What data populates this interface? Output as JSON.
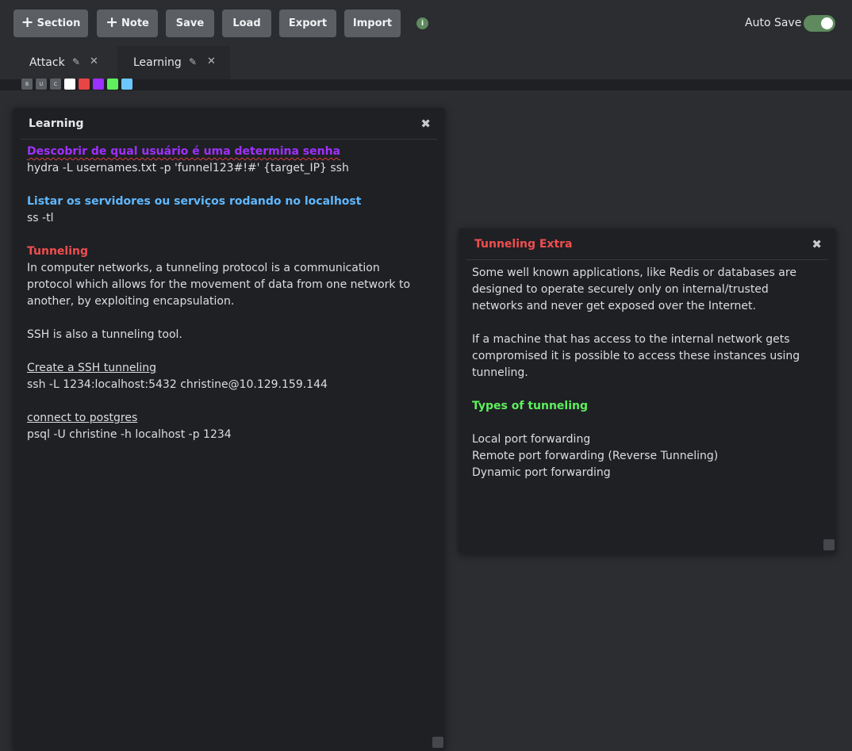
{
  "toolbar": {
    "add_section_label": "Section",
    "add_note_label": "Note",
    "save_label": "Save",
    "load_label": "Load",
    "export_label": "Export",
    "import_label": "Import",
    "info_glyph": "i",
    "autosave_label": "Auto Save",
    "autosave_on": true
  },
  "tabs": [
    {
      "label": "Attack",
      "active": false
    },
    {
      "label": "Learning",
      "active": true
    }
  ],
  "tab_glyphs": {
    "edit": "✎",
    "close": "✕"
  },
  "format_bar": {
    "buttons": [
      "B",
      "U",
      "C"
    ],
    "colors": [
      "#ffffff",
      "#e84545",
      "#9b30ff",
      "#5ef05e",
      "#6ec6ff"
    ]
  },
  "notes": {
    "learning": {
      "title": "Learning",
      "title_color": "#e6e7e9",
      "close_glyph": "✖",
      "lines": {
        "l1": "Descobrir de qual usuário é uma determina senha",
        "l2": "hydra -L usernames.txt -p 'funnel123#!#' {target_IP} ssh",
        "l3": "Listar os servidores ou serviços rodando no localhost",
        "l4": "ss -tl",
        "l5": "Tunneling",
        "l6": "In computer networks, a tunneling protocol is a communication protocol which allows for the movement of data from one network to another, by exploiting encapsulation.",
        "l7": "SSH is also a tunneling tool.",
        "l8": "Create a SSH tunneling",
        "l9": "ssh -L 1234:localhost:5432 christine@10.129.159.144",
        "l10": "connect to postgres",
        "l11": "psql -U christine -h localhost -p 1234"
      }
    },
    "tunneling_extra": {
      "title": "Tunneling Extra",
      "title_color": "#f04e4e",
      "close_glyph": "✖",
      "lines": {
        "p1": "Some well known applications, like Redis or databases are designed to operate securely only on internal/trusted networks and never get exposed over the Internet.",
        "p2": "If a machine that has access to the internal network gets compromised it is possible to access these instances using tunneling.",
        "h1": "Types of tunneling",
        "i1": "Local port forwarding",
        "i2": "Remote port forwarding (Reverse Tunneling)",
        "i3": "Dynamic port forwarding"
      }
    }
  },
  "colors": {
    "purple_heading": "#a030ff",
    "blue_heading": "#5fb8ff",
    "red_heading": "#f04e4e",
    "green_heading": "#5ef05e",
    "accent_toggle": "#5e8a5e"
  }
}
